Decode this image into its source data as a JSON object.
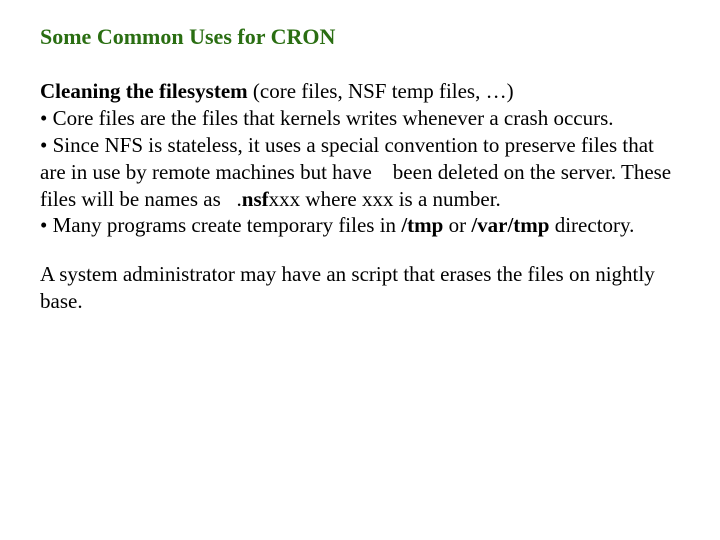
{
  "title_color": "#2a6e12",
  "title": "Some Common Uses for CRON",
  "p1_lead_bold": "Cleaning the filesystem",
  "p1_lead_rest": " (core files, NSF temp files, …)",
  "p1_b1": "• Core files are the files that kernels writes whenever a crash occurs.",
  "p1_b2a": "• Since NFS is stateless, it uses a special convention to preserve files that are in use by remote machines but have    been deleted on the server.  These files will be names as   .",
  "p1_b2_bold": "nsf",
  "p1_b2b": "xxx where xxx is a number.",
  "p1_b3a": "• Many programs create temporary files in ",
  "p1_b3_bold1": "/tmp",
  "p1_b3_mid": " or ",
  "p1_b3_bold2": "/var/tmp",
  "p1_b3b": " directory.",
  "p2": "A system administrator may have an script that erases the files on nightly base."
}
